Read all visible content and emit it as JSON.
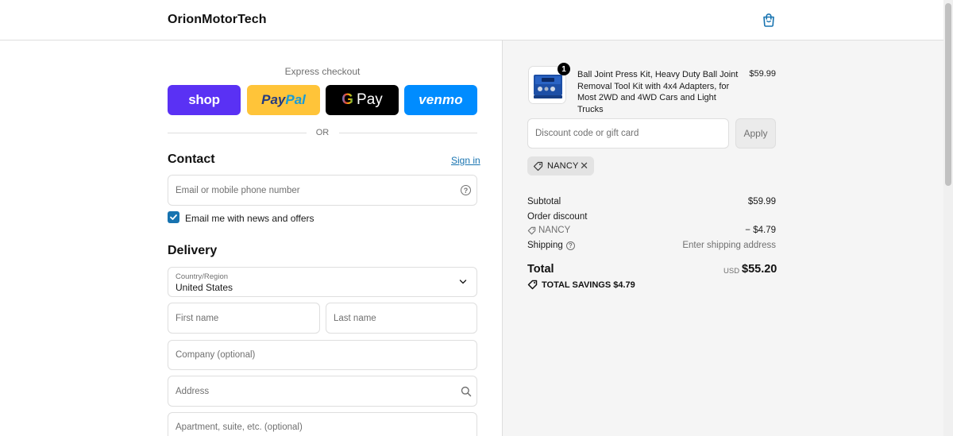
{
  "header": {
    "brand": "OrionMotorTech",
    "cart_icon": "shopping-bag-icon"
  },
  "express": {
    "label": "Express checkout",
    "buttons": {
      "shop": "shop",
      "paypal_1": "Pay",
      "paypal_2": "Pal",
      "gpay_g": "G",
      "gpay": "Pay",
      "venmo": "venmo"
    },
    "or": "OR"
  },
  "contact": {
    "title": "Contact",
    "sign_in": "Sign in",
    "email_placeholder": "Email or mobile phone number",
    "newsletter_label": "Email me with news and offers",
    "newsletter_checked": true
  },
  "delivery": {
    "title": "Delivery",
    "country_label": "Country/Region",
    "country_value": "United States",
    "first_name_placeholder": "First name",
    "last_name_placeholder": "Last name",
    "company_placeholder": "Company (optional)",
    "address_placeholder": "Address",
    "apartment_placeholder": "Apartment, suite, etc. (optional)"
  },
  "summary": {
    "product": {
      "name": "Ball Joint Press Kit, Heavy Duty Ball Joint Removal Tool Kit with 4x4 Adapters, for Most 2WD and 4WD Cars and Light Trucks",
      "price": "$59.99",
      "quantity": "1"
    },
    "discount_placeholder": "Discount code or gift card",
    "apply_label": "Apply",
    "applied_code": "NANCY",
    "subtotal_label": "Subtotal",
    "subtotal_value": "$59.99",
    "order_discount_label": "Order discount",
    "discount_code": "NANCY",
    "discount_value": "− $4.79",
    "shipping_label": "Shipping",
    "shipping_value": "Enter shipping address",
    "total_label": "Total",
    "total_currency": "USD",
    "total_value": "$55.20",
    "savings_label": "TOTAL SAVINGS $4.79"
  },
  "colors": {
    "accent": "#1773b0",
    "shop": "#5a31f4",
    "paypal": "#ffc439",
    "venmo": "#008cff",
    "panel_bg": "#f5f5f5"
  }
}
